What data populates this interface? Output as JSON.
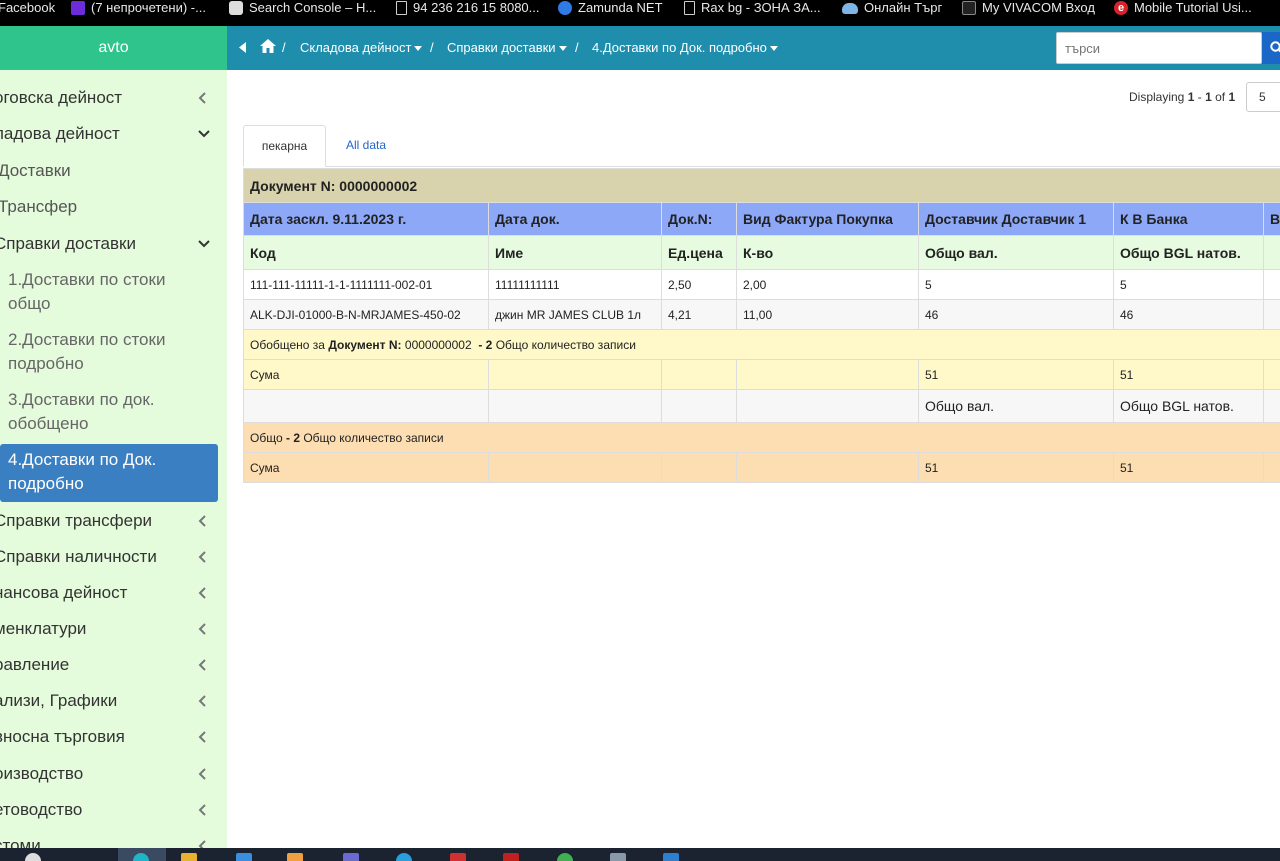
{
  "bookmarks": [
    {
      "label": "Facebook",
      "icon": "facebook-icon"
    },
    {
      "label": "(7 непрочетени) -...",
      "icon": "mail-icon"
    },
    {
      "label": "Search Console – H...",
      "icon": "search-console-icon"
    },
    {
      "label": "94 236 216 15 8080...",
      "icon": "page-icon"
    },
    {
      "label": "Zamunda NET",
      "icon": "globe-icon"
    },
    {
      "label": "Rax bg - ЗОНА ЗА...",
      "icon": "page-icon"
    },
    {
      "label": "Онлайн Търг",
      "icon": "cloud-icon"
    },
    {
      "label": "My VIVACOM Вход",
      "icon": "vivacom-icon"
    },
    {
      "label": "Mobile Tutorial Usi...",
      "icon": "edge-icon"
    }
  ],
  "sidebar": {
    "brand": "avto",
    "items": [
      {
        "label": "оговска дейност",
        "state": "collapsed"
      },
      {
        "label": "ладова дейност",
        "state": "expanded"
      },
      {
        "label": "Доставки"
      },
      {
        "label": "Трансфер"
      },
      {
        "label": "Справки доставки",
        "state": "expanded"
      },
      {
        "label": "1.Доставки по стоки общо"
      },
      {
        "label": "2.Доставки по стоки подробно"
      },
      {
        "label": "3.Доставки по док. обобщено"
      },
      {
        "label": "4.Доставки по Док. подробно",
        "state": "active"
      },
      {
        "label": "Справки трансфери",
        "state": "collapsed"
      },
      {
        "label": "Справки наличности",
        "state": "collapsed"
      },
      {
        "label": "нансова дейност",
        "state": "collapsed"
      },
      {
        "label": "менклатури",
        "state": "collapsed"
      },
      {
        "label": "равление",
        "state": "collapsed"
      },
      {
        "label": "ализи, Графики",
        "state": "collapsed"
      },
      {
        "label": "вносна търговия",
        "state": "collapsed"
      },
      {
        "label": "оизводство",
        "state": "collapsed"
      },
      {
        "label": "етоводство",
        "state": "collapsed"
      },
      {
        "label": "стоми",
        "state": "collapsed"
      }
    ]
  },
  "breadcrumb": {
    "items": [
      "Складова дейност",
      "Справки доставки",
      "4.Доставки по Док. подробно"
    ]
  },
  "search": {
    "placeholder": "търси"
  },
  "pager": {
    "prefix": "Displaying",
    "from": "1",
    "sep": "-",
    "to": "1",
    "of_label": "of",
    "total": "1",
    "per_page": "5"
  },
  "tabs": [
    {
      "label": "пекарна",
      "active": true
    },
    {
      "label": "All data",
      "active": false
    }
  ],
  "report": {
    "doc_title": "Документ N: 0000000002",
    "header_row": [
      "Дата заскл. 9.11.2023 г.",
      "Дата док.",
      "Док.N:",
      "Вид Фактура Покупка",
      "Доставчик Доставчик 1",
      "К В Банка",
      "В"
    ],
    "sub_header": [
      "Код",
      "Име",
      "Ед.цена",
      "К-во",
      "Общо вал.",
      "Общо BGL натов.",
      ""
    ],
    "rows": [
      [
        "111-111-11111-1-1-1111111-002-01",
        "11111111111",
        "2,50",
        "2,00",
        "5",
        "5",
        ""
      ],
      [
        "ALK-DJI-01000-B-N-MRJAMES-450-02",
        "джин MR JAMES CLUB 1л",
        "4,21",
        "11,00",
        "46",
        "46",
        ""
      ]
    ],
    "summary": {
      "prefix": "Обобщено за",
      "doc": "Документ N:",
      "doc_no": "0000000002",
      "dash": "-",
      "count": "2",
      "suffix": "Общо количество записи"
    },
    "sum_row": [
      "Сума",
      "",
      "",
      "",
      "51",
      "51",
      ""
    ],
    "footer_labels": [
      "",
      "",
      "",
      "",
      "Общо вал.",
      "Общо BGL натов.",
      ""
    ],
    "total": {
      "prefix": "Общо",
      "dash": "-",
      "count": "2",
      "suffix": "Общо количество записи"
    },
    "total_sum_row": [
      "Сума",
      "",
      "",
      "",
      "51",
      "51",
      ""
    ]
  },
  "colors": {
    "sidebar_bg": "#e4fbdc",
    "brand_bg": "#2fc48c",
    "topnav_bg": "#1f8eac",
    "active_item": "#3a7fc2",
    "doc_row": "#d8d3ac",
    "header_row": "#8da8f7",
    "sub_header": "#e6fbe0",
    "summary_row": "#fff8c8",
    "total_row": "#fddeb2"
  }
}
